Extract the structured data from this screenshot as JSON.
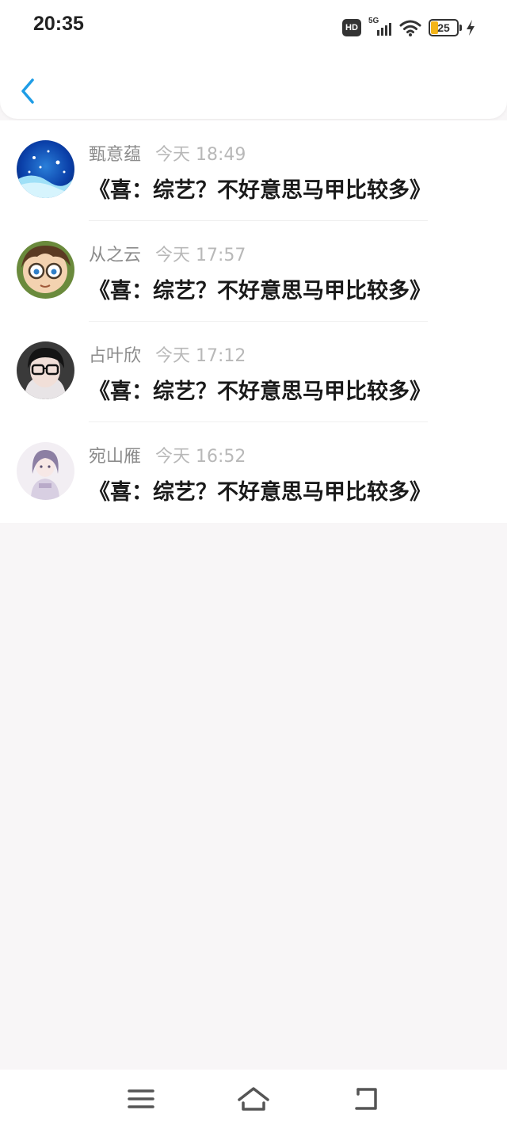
{
  "status_bar": {
    "time": "20:35",
    "hd_label": "HD",
    "network_label": "5G",
    "battery_level": "25",
    "icons": [
      "hd-icon",
      "signal-5g-icon",
      "wifi-icon",
      "battery-icon",
      "charging-bolt-icon"
    ]
  },
  "header": {
    "back_icon": "chevron-left-icon",
    "accent_color": "#1f9de6"
  },
  "messages": [
    {
      "name": "甄意蕴",
      "time": "今天 18:49",
      "title": "《喜：综艺？不好意思马甲比较多》",
      "avatar": "snowflake-avatar"
    },
    {
      "name": "从之云",
      "time": "今天 17:57",
      "title": "《喜：综艺？不好意思马甲比较多》",
      "avatar": "anime-glasses-avatar"
    },
    {
      "name": "占叶欣",
      "time": "今天 17:12",
      "title": "《喜：综艺？不好意思马甲比较多》",
      "avatar": "person-glasses-avatar"
    },
    {
      "name": "宛山雁",
      "time": "今天 16:52",
      "title": "《喜：综艺？不好意思马甲比较多》",
      "avatar": "anime-girl-avatar"
    }
  ],
  "nav_bar": {
    "icons": [
      "menu-icon",
      "home-icon",
      "back-icon"
    ]
  }
}
